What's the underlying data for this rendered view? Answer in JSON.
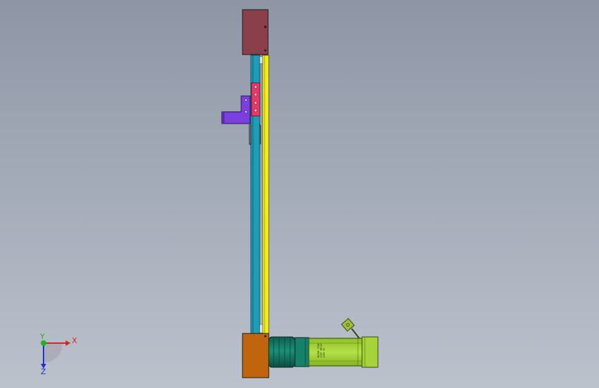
{
  "viewport": {
    "background_top": "#8e96a6",
    "background_bottom": "#bcc2cc"
  },
  "model": {
    "colors": {
      "top_cap": "#8a3f4a",
      "bottom_cap": "#c0650e",
      "rail_blue": "#1f9db8",
      "rail_yellow": "#f4ef1a",
      "slider_pink": "#e8386a",
      "bracket_purple": "#7b3fe0",
      "coupling_teal": "#137563",
      "motor_green": "#a6d33a",
      "connector_green": "#9fbf3a"
    },
    "motor_label_lines": [
      "MOTOR 750W",
      "STEP DRIVE",
      "220V AC"
    ]
  },
  "triad": {
    "x_label": "X",
    "y_label": "Y",
    "z_label": "Z",
    "x_color": "#e0201c",
    "y_color": "#18b818",
    "z_color": "#2430d8"
  }
}
